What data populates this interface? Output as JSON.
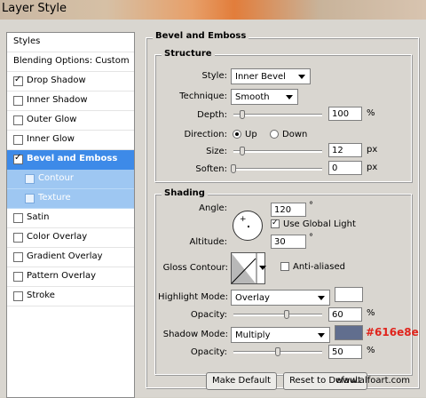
{
  "window": {
    "title": "Layer Style"
  },
  "sidebar": {
    "header": "Styles",
    "blending": "Blending Options: Custom",
    "items": [
      {
        "label": "Drop Shadow",
        "checked": true
      },
      {
        "label": "Inner Shadow",
        "checked": false
      },
      {
        "label": "Outer Glow",
        "checked": false
      },
      {
        "label": "Inner Glow",
        "checked": false
      },
      {
        "label": "Bevel and Emboss",
        "checked": true
      },
      {
        "label": "Contour",
        "checked": false
      },
      {
        "label": "Texture",
        "checked": false
      },
      {
        "label": "Satin",
        "checked": false
      },
      {
        "label": "Color Overlay",
        "checked": false
      },
      {
        "label": "Gradient Overlay",
        "checked": false
      },
      {
        "label": "Pattern Overlay",
        "checked": false
      },
      {
        "label": "Stroke",
        "checked": false
      }
    ]
  },
  "bevel": {
    "section_title": "Bevel and Emboss",
    "structure": {
      "title": "Structure",
      "style_label": "Style:",
      "style_value": "Inner Bevel",
      "technique_label": "Technique:",
      "technique_value": "Smooth",
      "depth_label": "Depth:",
      "depth_value": "100",
      "depth_unit": "%",
      "depth_level": 0.1,
      "direction_label": "Direction:",
      "direction_up": "Up",
      "direction_down": "Down",
      "direction_selected": "Up",
      "size_label": "Size:",
      "size_value": "12",
      "size_unit": "px",
      "size_level": 0.1,
      "soften_label": "Soften:",
      "soften_value": "0",
      "soften_unit": "px",
      "soften_level": 0.0
    },
    "shading": {
      "title": "Shading",
      "angle_label": "Angle:",
      "angle_value": "120",
      "angle_unit": "°",
      "use_global_light_label": "Use Global Light",
      "use_global_light": true,
      "altitude_label": "Altitude:",
      "altitude_value": "30",
      "altitude_unit": "°",
      "gloss_contour_label": "Gloss Contour:",
      "anti_aliased_label": "Anti-aliased",
      "anti_aliased": false,
      "highlight_mode_label": "Highlight Mode:",
      "highlight_mode_value": "Overlay",
      "highlight_color": "#ffffff",
      "highlight_opacity_label": "Opacity:",
      "highlight_opacity_value": "60",
      "highlight_opacity_unit": "%",
      "highlight_opacity_level": 0.6,
      "shadow_mode_label": "Shadow Mode:",
      "shadow_mode_value": "Multiply",
      "shadow_color": "#616e8e",
      "shadow_color_note": "#616e8e",
      "shadow_opacity_label": "Opacity:",
      "shadow_opacity_value": "50",
      "shadow_opacity_unit": "%",
      "shadow_opacity_level": 0.5
    }
  },
  "buttons": {
    "make_default": "Make Default",
    "reset_default": "Reset to Default"
  },
  "watermark": "www.alfoart.com",
  "icons": {
    "dial_cross": "+",
    "check": "✓"
  }
}
